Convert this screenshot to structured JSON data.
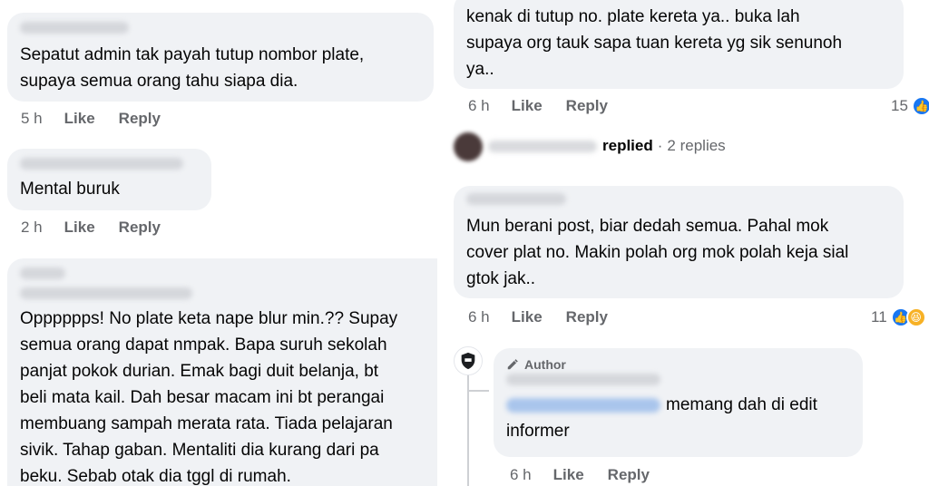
{
  "left": {
    "comments": [
      {
        "text": "Sepatut admin tak payah tutup nombor plate,\nsupaya semua orang tahu siapa dia.",
        "time": "5 h",
        "like": "Like",
        "reply": "Reply"
      },
      {
        "text": "Mental buruk",
        "time": "2 h",
        "like": "Like",
        "reply": "Reply"
      },
      {
        "text": "Opppppps! No plate keta nape blur min.?? Supay\nsemua orang dapat nmpak. Bapa suruh sekolah\npanjat pokok durian. Emak bagi duit belanja, bt\nbeli mata kail. Dah besar macam ini bt perangai\nmembuang sampah merata rata. Tiada pelajaran\nsivik.  Tahap gaban. Mentaliti dia kurang dari pa\nbeku. Sebab otak dia tggl di rumah."
      }
    ]
  },
  "right": {
    "comment1": {
      "text": "kenak di tutup no. plate kereta ya.. buka lah\nsupaya org tauk sapa tuan kereta yg sik senunoh\nya..",
      "time": "6 h",
      "like": "Like",
      "reply": "Reply",
      "reactions": "15"
    },
    "replies": {
      "replied": "replied",
      "dot": "·",
      "count": "2 replies"
    },
    "comment2": {
      "text": "Mun berani post, biar dedah semua. Pahal mok\ncover plat no. Makin polah org mok polah keja sial\ngtok jak..",
      "time": "6 h",
      "like": "Like",
      "reply": "Reply",
      "reactions": "11"
    },
    "author_reply": {
      "badge": "Author",
      "text_line1": "memang dah di edit",
      "text_line2": "informer",
      "time": "6 h",
      "like": "Like",
      "reply": "Reply"
    }
  },
  "icons": {
    "like": "like-icon",
    "haha": "haha-icon",
    "author": "pencil-icon"
  },
  "colors": {
    "bubble": "#f0f2f5",
    "meta": "#65676b",
    "like_blue": "#1877f2",
    "haha_yellow": "#f7b125"
  }
}
